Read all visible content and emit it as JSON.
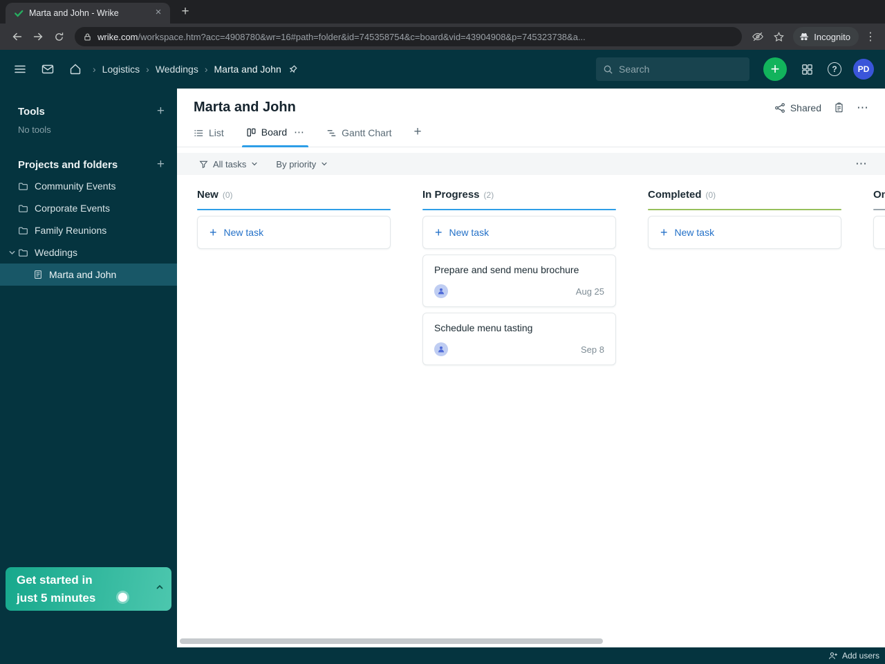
{
  "icons": {
    "plus": "+",
    "close": "×",
    "kebab": "⋮",
    "ellipsis": "⋯",
    "crumb_sep": "›",
    "help": "?"
  },
  "browser": {
    "tab_title": "Marta and John - Wrike",
    "url_domain": "wrike.com",
    "url_rest": "/workspace.htm?acc=4908780&wr=16#path=folder&id=745358754&c=board&vid=43904908&p=745323738&a...",
    "incognito_label": "Incognito"
  },
  "app_header": {
    "breadcrumb": [
      "Logistics",
      "Weddings",
      "Marta and John"
    ],
    "search_placeholder": "Search",
    "avatar_initials": "PD"
  },
  "sidebar": {
    "tools_title": "Tools",
    "tools_empty": "No tools",
    "projects_title": "Projects and folders",
    "folders": [
      {
        "label": "Community Events"
      },
      {
        "label": "Corporate Events"
      },
      {
        "label": "Family Reunions"
      },
      {
        "label": "Weddings"
      }
    ],
    "selected_item": "Marta and John",
    "promo_line1": "Get started in",
    "promo_line2": "just 5 minutes"
  },
  "main": {
    "title": "Marta and John",
    "shared_label": "Shared",
    "tabs": {
      "list": "List",
      "board": "Board",
      "gantt": "Gantt Chart"
    },
    "filters": {
      "scope": "All tasks",
      "grouping": "By priority"
    },
    "board": {
      "new_task_label": "New task",
      "columns": [
        {
          "name": "New",
          "count": "(0)",
          "accent": "#2e9ee7"
        },
        {
          "name": "In Progress",
          "count": "(2)",
          "accent": "#2e9ee7",
          "tasks": [
            {
              "title": "Prepare and send menu brochure",
              "date": "Aug 25"
            },
            {
              "title": "Schedule menu tasting",
              "date": "Sep 8"
            }
          ]
        },
        {
          "name": "Completed",
          "count": "(0)",
          "accent": "#97c05c"
        },
        {
          "name": "On",
          "count": "",
          "accent": "#9aa6ad"
        }
      ]
    }
  },
  "footer": {
    "add_users_label": "Add users"
  },
  "colors": {
    "header_teal": "#05343f",
    "accent_blue": "#2e9ee7",
    "accent_green": "#97c05c",
    "brand_green": "#12b35c",
    "link_blue": "#2471c8"
  }
}
